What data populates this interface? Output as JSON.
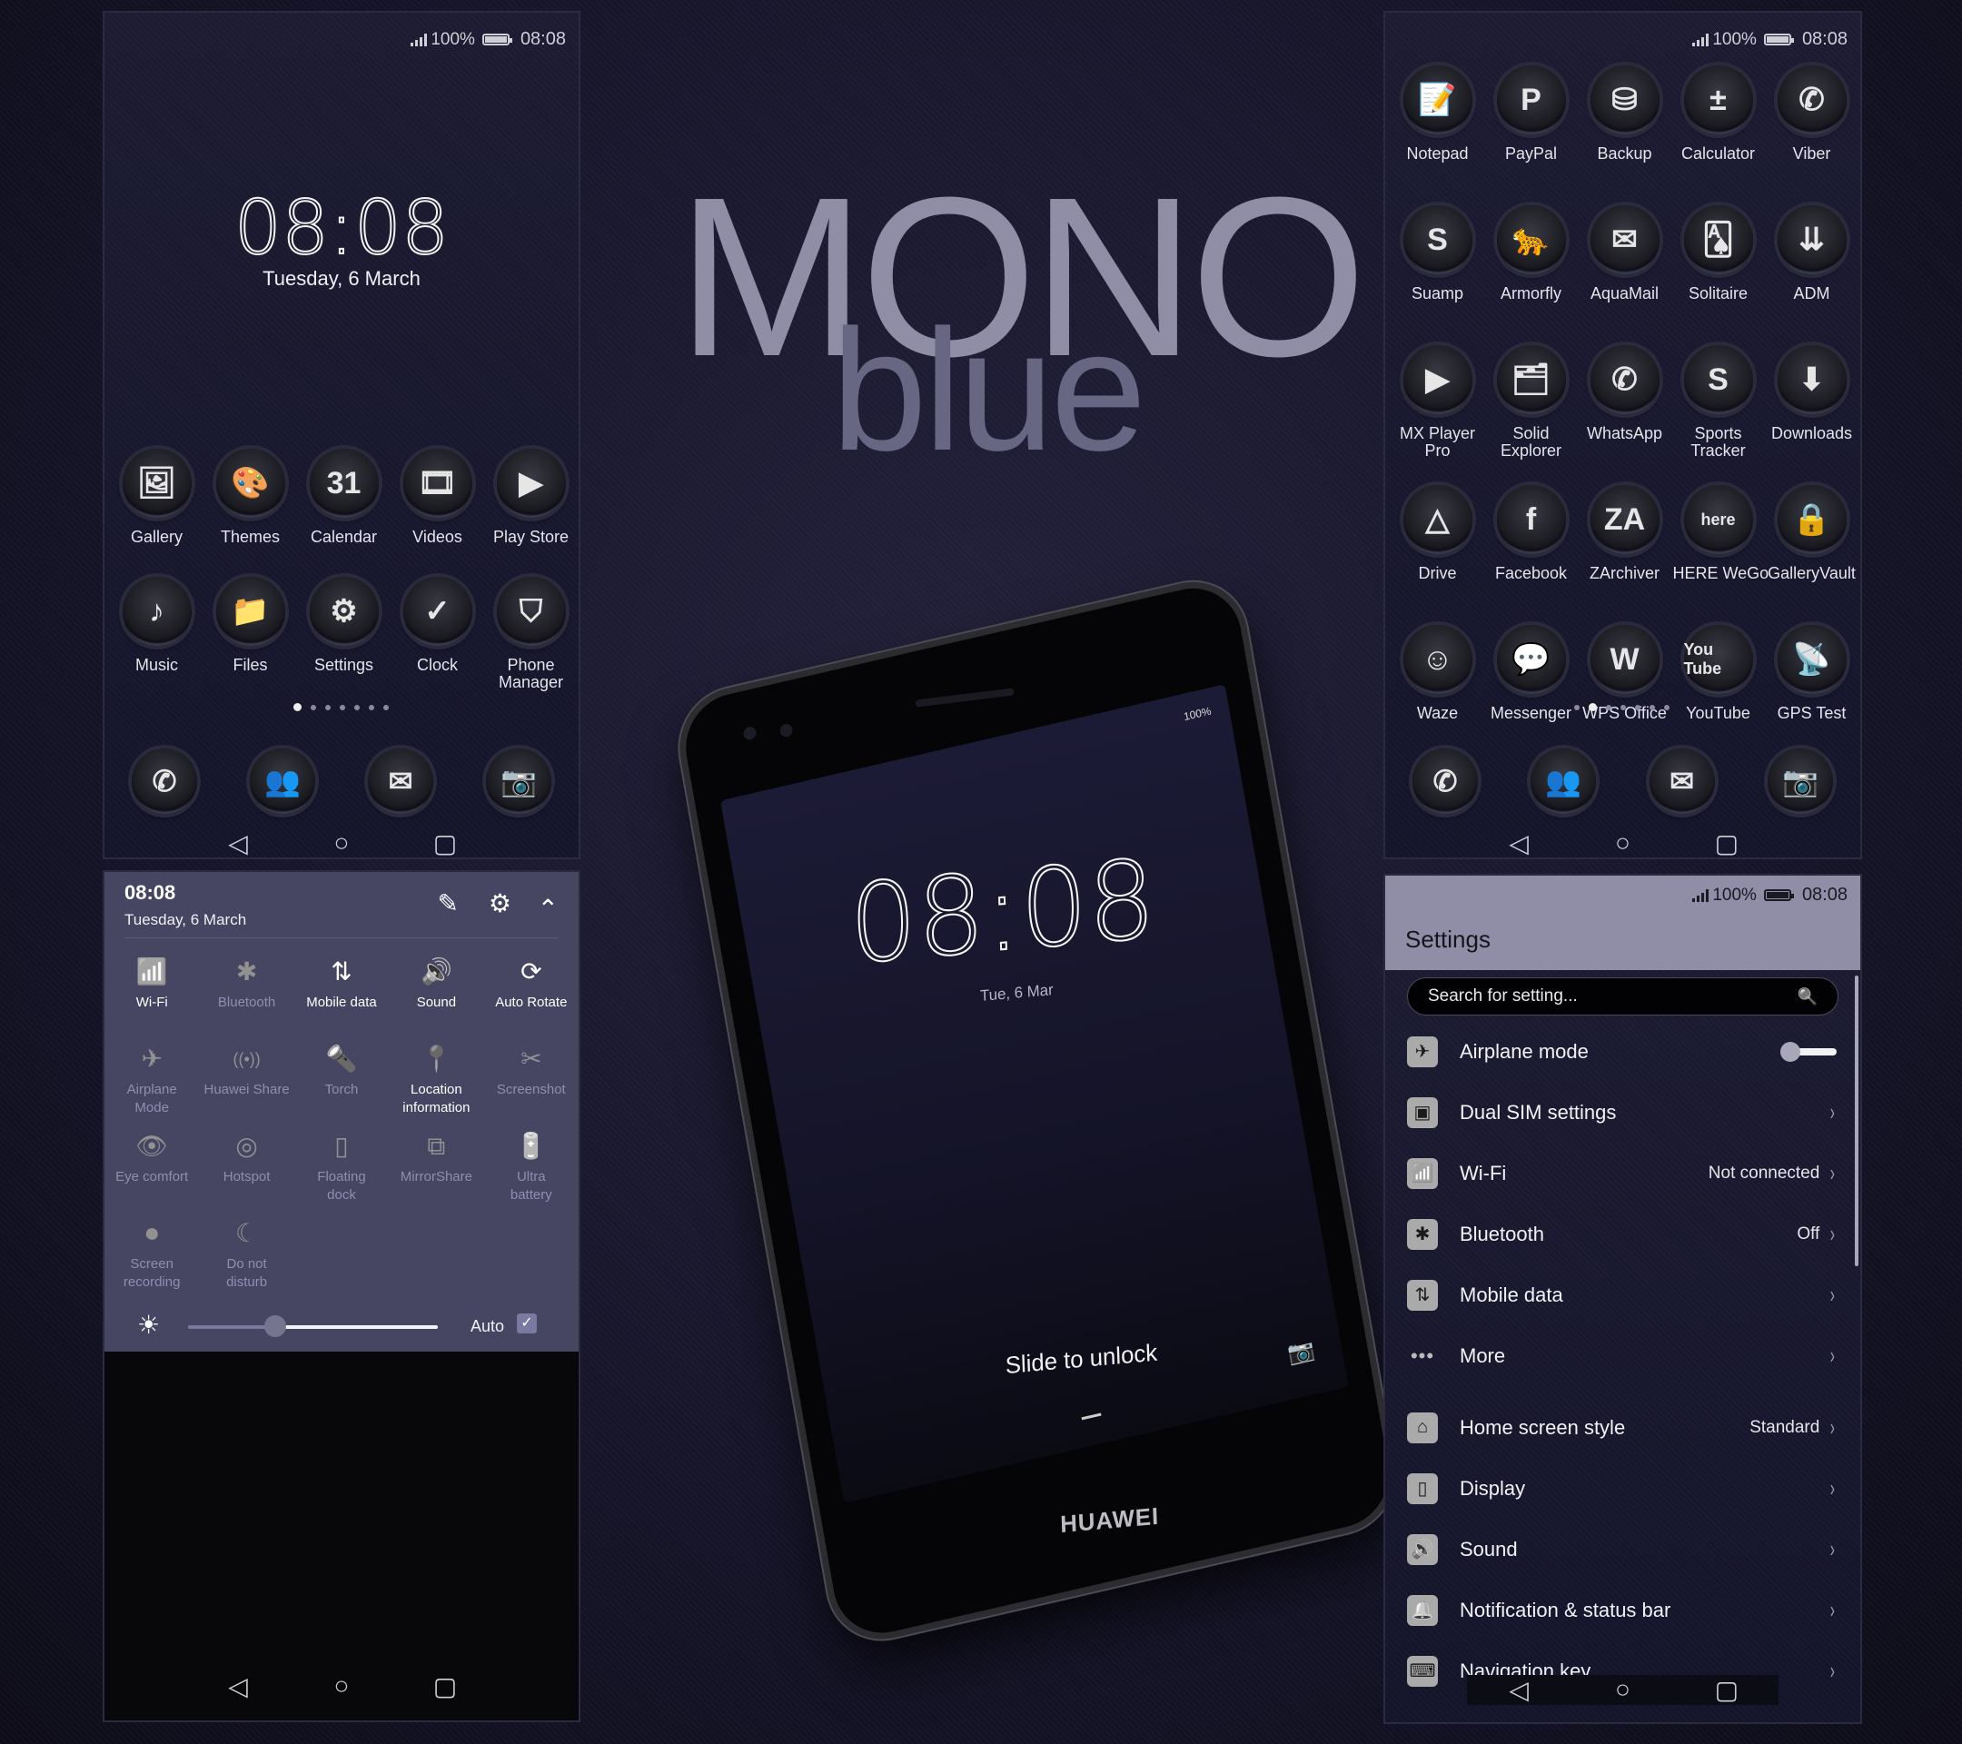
{
  "status": {
    "signal": "signal-icon",
    "battery_pct": "100%",
    "time": "08:08"
  },
  "title": {
    "line1": "MONO",
    "line2": "blue"
  },
  "home": {
    "clock": "08:08",
    "date": "Tuesday, 6 March",
    "apps": [
      {
        "label": "Gallery",
        "icon": "🖼"
      },
      {
        "label": "Themes",
        "icon": "🎨"
      },
      {
        "label": "Calendar",
        "icon": "31"
      },
      {
        "label": "Videos",
        "icon": "🎞"
      },
      {
        "label": "Play Store",
        "icon": "▶"
      },
      {
        "label": "Music",
        "icon": "♪"
      },
      {
        "label": "Files",
        "icon": "📁"
      },
      {
        "label": "Settings",
        "icon": "⚙"
      },
      {
        "label": "Clock",
        "icon": "✓"
      },
      {
        "label": "Phone Manager",
        "icon": "⛉"
      }
    ],
    "page_count": 7,
    "active_page": 1,
    "dock": [
      {
        "name": "phone",
        "icon": "✆"
      },
      {
        "name": "contacts",
        "icon": "👥"
      },
      {
        "name": "messages",
        "icon": "✉"
      },
      {
        "name": "camera",
        "icon": "📷"
      }
    ]
  },
  "nav": {
    "back": "◁",
    "home": "○",
    "recents": "▢"
  },
  "shade": {
    "time": "08:08",
    "date": "Tuesday, 6 March",
    "edit_icon": "✎",
    "settings_icon": "⚙",
    "collapse_icon": "⌃",
    "tiles": [
      {
        "label": "Wi-Fi",
        "icon": "📶",
        "on": true
      },
      {
        "label": "Bluetooth",
        "icon": "✱",
        "on": false
      },
      {
        "label": "Mobile data",
        "icon": "⇅",
        "on": true
      },
      {
        "label": "Sound",
        "icon": "🔊",
        "on": true
      },
      {
        "label": "Auto Rotate",
        "icon": "⟳",
        "on": true
      },
      {
        "label": "Airplane Mode",
        "icon": "✈",
        "on": false
      },
      {
        "label": "Huawei Share",
        "icon": "((•))",
        "on": false
      },
      {
        "label": "Torch",
        "icon": "🔦",
        "on": false
      },
      {
        "label": "Location information",
        "icon": "📍",
        "on": true
      },
      {
        "label": "Screenshot",
        "icon": "✂",
        "on": false
      },
      {
        "label": "Eye comfort",
        "icon": "👁",
        "on": false
      },
      {
        "label": "Hotspot",
        "icon": "◎",
        "on": false
      },
      {
        "label": "Floating dock",
        "icon": "▯",
        "on": false
      },
      {
        "label": "MirrorShare",
        "icon": "⧉",
        "on": false
      },
      {
        "label": "Ultra battery",
        "icon": "🔋",
        "on": false
      },
      {
        "label": "Screen recording",
        "icon": "⏺",
        "on": false
      },
      {
        "label": "Do not disturb",
        "icon": "☾",
        "on": false
      }
    ],
    "brightness_icon": "☀",
    "brightness_level": 0.35,
    "auto_label": "Auto",
    "auto_checked": true
  },
  "drawer": {
    "apps": [
      {
        "label": "Notepad",
        "icon": "📝"
      },
      {
        "label": "PayPal",
        "icon": "P"
      },
      {
        "label": "Backup",
        "icon": "⛁"
      },
      {
        "label": "Calculator",
        "icon": "±"
      },
      {
        "label": "Viber",
        "icon": "✆"
      },
      {
        "label": "Suamp",
        "icon": "S"
      },
      {
        "label": "Armorfly",
        "icon": "🐆"
      },
      {
        "label": "AquaMail",
        "icon": "✉"
      },
      {
        "label": "Solitaire",
        "icon": "🂡"
      },
      {
        "label": "ADM",
        "icon": "⇊"
      },
      {
        "label": "MX Player Pro",
        "icon": "▶"
      },
      {
        "label": "Solid Explorer",
        "icon": "🗂"
      },
      {
        "label": "WhatsApp",
        "icon": "✆"
      },
      {
        "label": "Sports Tracker",
        "icon": "S"
      },
      {
        "label": "Downloads",
        "icon": "⬇"
      },
      {
        "label": "Drive",
        "icon": "△"
      },
      {
        "label": "Facebook",
        "icon": "f"
      },
      {
        "label": "ZArchiver",
        "icon": "ZA"
      },
      {
        "label": "HERE WeGo",
        "icon": "here"
      },
      {
        "label": "GalleryVault",
        "icon": "🔒"
      },
      {
        "label": "Waze",
        "icon": "☺"
      },
      {
        "label": "Messenger",
        "icon": "💬"
      },
      {
        "label": "WPS Office",
        "icon": "W"
      },
      {
        "label": "YouTube",
        "icon": "You Tube"
      },
      {
        "label": "GPS Test",
        "icon": "📡"
      }
    ],
    "page_count": 7,
    "active_page": 2
  },
  "settings": {
    "title": "Settings",
    "search_placeholder": "Search for setting...",
    "search_icon": "🔍",
    "rows": [
      {
        "label": "Airplane mode",
        "icon": "✈",
        "toggle": true,
        "toggle_on": false
      },
      {
        "label": "Dual SIM settings",
        "icon": "▣",
        "value": ""
      },
      {
        "label": "Wi-Fi",
        "icon": "📶",
        "value": "Not connected"
      },
      {
        "label": "Bluetooth",
        "icon": "✱",
        "value": "Off"
      },
      {
        "label": "Mobile data",
        "icon": "⇅",
        "value": ""
      },
      {
        "label": "More",
        "icon": "•••",
        "value": "",
        "plain": true
      },
      {
        "label": "Home screen style",
        "icon": "⌂",
        "value": "Standard",
        "gap": true
      },
      {
        "label": "Display",
        "icon": "▯",
        "value": ""
      },
      {
        "label": "Sound",
        "icon": "🔊",
        "value": ""
      },
      {
        "label": "Notification & status bar",
        "icon": "🔔",
        "value": ""
      },
      {
        "label": "Navigation key",
        "icon": "⌨",
        "value": ""
      }
    ],
    "chevron": "›"
  },
  "phone": {
    "status": "100%",
    "clock": "08:08",
    "date": "Tue, 6 Mar",
    "unlock_text": "Slide to unlock",
    "camera_icon": "📷",
    "brand": "HUAWEI"
  }
}
